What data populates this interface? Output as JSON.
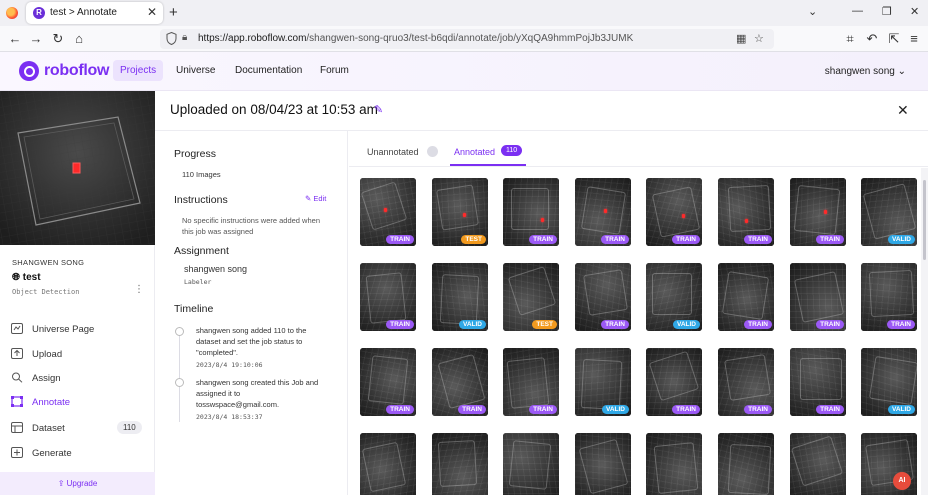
{
  "browser": {
    "tab_title": "test > Annotate",
    "tab_favicon": "R",
    "url_domain": "https://app.roboflow.com",
    "url_path": "/shangwen-song-qruo3/test-b6qdi/annotate/job/yXqQA9hmmPojJb3JUMK",
    "new_tab": "+",
    "close_tab": "✕"
  },
  "header": {
    "logo_text": "roboflow",
    "nav": [
      {
        "label": "Projects",
        "active": true
      },
      {
        "label": "Universe",
        "active": false
      },
      {
        "label": "Documentation",
        "active": false
      },
      {
        "label": "Forum",
        "active": false
      }
    ],
    "user": "shangwen song"
  },
  "sidebar": {
    "owner": "SHANGWEN SONG",
    "project_name": "test",
    "project_type": "Object Detection",
    "items": [
      {
        "label": "Universe Page",
        "icon": "universe-page-icon",
        "active": false
      },
      {
        "label": "Upload",
        "icon": "upload-icon",
        "active": false
      },
      {
        "label": "Assign",
        "icon": "search-icon",
        "active": false
      },
      {
        "label": "Annotate",
        "icon": "annotate-icon",
        "active": true
      },
      {
        "label": "Dataset",
        "icon": "dataset-icon",
        "active": false,
        "badge": "110"
      },
      {
        "label": "Generate",
        "icon": "generate-icon",
        "active": false
      }
    ],
    "upgrade": "Upgrade"
  },
  "job": {
    "title": "Uploaded on 08/04/23 at 10:53 am",
    "progress_heading": "Progress",
    "progress_value": "110 Images",
    "instructions_heading": "Instructions",
    "instructions_edit": "Edit",
    "instructions_text_1": "No specific instructions were added when",
    "instructions_text_2": "this job was assigned",
    "assignment_heading": "Assignment",
    "assignee": "shangwen song",
    "assignee_role": "Labeler",
    "timeline_heading": "Timeline",
    "timeline": [
      {
        "lines": [
          "shangwen song added 110 to the",
          "dataset and set the job status to",
          "\"completed\"."
        ],
        "time": "2023/8/4 19:10:06"
      },
      {
        "lines": [
          "shangwen song created this Job and",
          "assigned it to",
          "tosswspace@gmail.com."
        ],
        "time": "2023/8/4 18:53:37"
      }
    ]
  },
  "tabs": {
    "unannotated_label": "Unannotated",
    "annotated_label": "Annotated",
    "annotated_count": "110"
  },
  "grid": {
    "rows": [
      [
        "TRAIN",
        "TEST",
        "TRAIN",
        "TRAIN",
        "TRAIN",
        "TRAIN",
        "TRAIN",
        "VALID"
      ],
      [
        "TRAIN",
        "VALID",
        "TEST",
        "TRAIN",
        "VALID",
        "TRAIN",
        "TRAIN",
        "TRAIN"
      ],
      [
        "TRAIN",
        "TRAIN",
        "TRAIN",
        "VALID",
        "TRAIN",
        "TRAIN",
        "TRAIN",
        "VALID"
      ],
      [
        "",
        "",
        "",
        "",
        "",
        "",
        "",
        ""
      ]
    ],
    "marker_color": "#ff2a2a"
  },
  "colors": {
    "brand": "#7b2ff2",
    "train": "#9b59f5",
    "test": "#f29a1f",
    "valid": "#2fa8e6"
  },
  "ai_button": "AI"
}
